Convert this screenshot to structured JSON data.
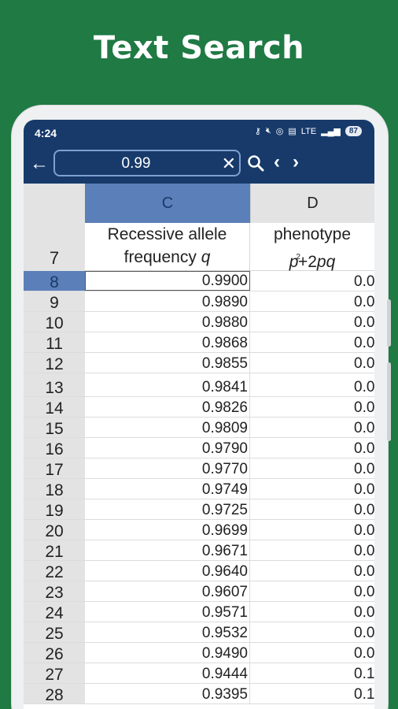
{
  "banner": {
    "title": "Text Search"
  },
  "status_bar": {
    "time": "4:24",
    "battery": "87",
    "network": "LTE"
  },
  "search": {
    "value": "0.99"
  },
  "columns": {
    "c": "C",
    "d": "D"
  },
  "header_row": {
    "row_number": "7",
    "c_line1": "Recessive allele",
    "c_line2": "frequency",
    "c_line2_var": "q",
    "d_line1": "phenotype",
    "d_line2_p": "p",
    "d_line2_sup": "2",
    "d_line2_rest": "+2",
    "d_line2_pq": "pq"
  },
  "rows": [
    {
      "n": "8",
      "c": "0.9900",
      "d": "0.0"
    },
    {
      "n": "9",
      "c": "0.9890",
      "d": "0.0"
    },
    {
      "n": "10",
      "c": "0.9880",
      "d": "0.0"
    },
    {
      "n": "11",
      "c": "0.9868",
      "d": "0.0"
    },
    {
      "n": "12",
      "c": "0.9855",
      "d": "0.0"
    },
    {
      "n": "13",
      "c": "0.9841",
      "d": "0.0"
    },
    {
      "n": "14",
      "c": "0.9826",
      "d": "0.0"
    },
    {
      "n": "15",
      "c": "0.9809",
      "d": "0.0"
    },
    {
      "n": "16",
      "c": "0.9790",
      "d": "0.0"
    },
    {
      "n": "17",
      "c": "0.9770",
      "d": "0.0"
    },
    {
      "n": "18",
      "c": "0.9749",
      "d": "0.0"
    },
    {
      "n": "19",
      "c": "0.9725",
      "d": "0.0"
    },
    {
      "n": "20",
      "c": "0.9699",
      "d": "0.0"
    },
    {
      "n": "21",
      "c": "0.9671",
      "d": "0.0"
    },
    {
      "n": "22",
      "c": "0.9640",
      "d": "0.0"
    },
    {
      "n": "23",
      "c": "0.9607",
      "d": "0.0"
    },
    {
      "n": "24",
      "c": "0.9571",
      "d": "0.0"
    },
    {
      "n": "25",
      "c": "0.9532",
      "d": "0.0"
    },
    {
      "n": "26",
      "c": "0.9490",
      "d": "0.0"
    },
    {
      "n": "27",
      "c": "0.9444",
      "d": "0.1"
    },
    {
      "n": "28",
      "c": "0.9395",
      "d": "0.1"
    }
  ],
  "selected_row": "8",
  "colors": {
    "banner_bg": "#1f7a44",
    "appbar_bg": "#173a6b",
    "selection": "#5b7fb8"
  }
}
